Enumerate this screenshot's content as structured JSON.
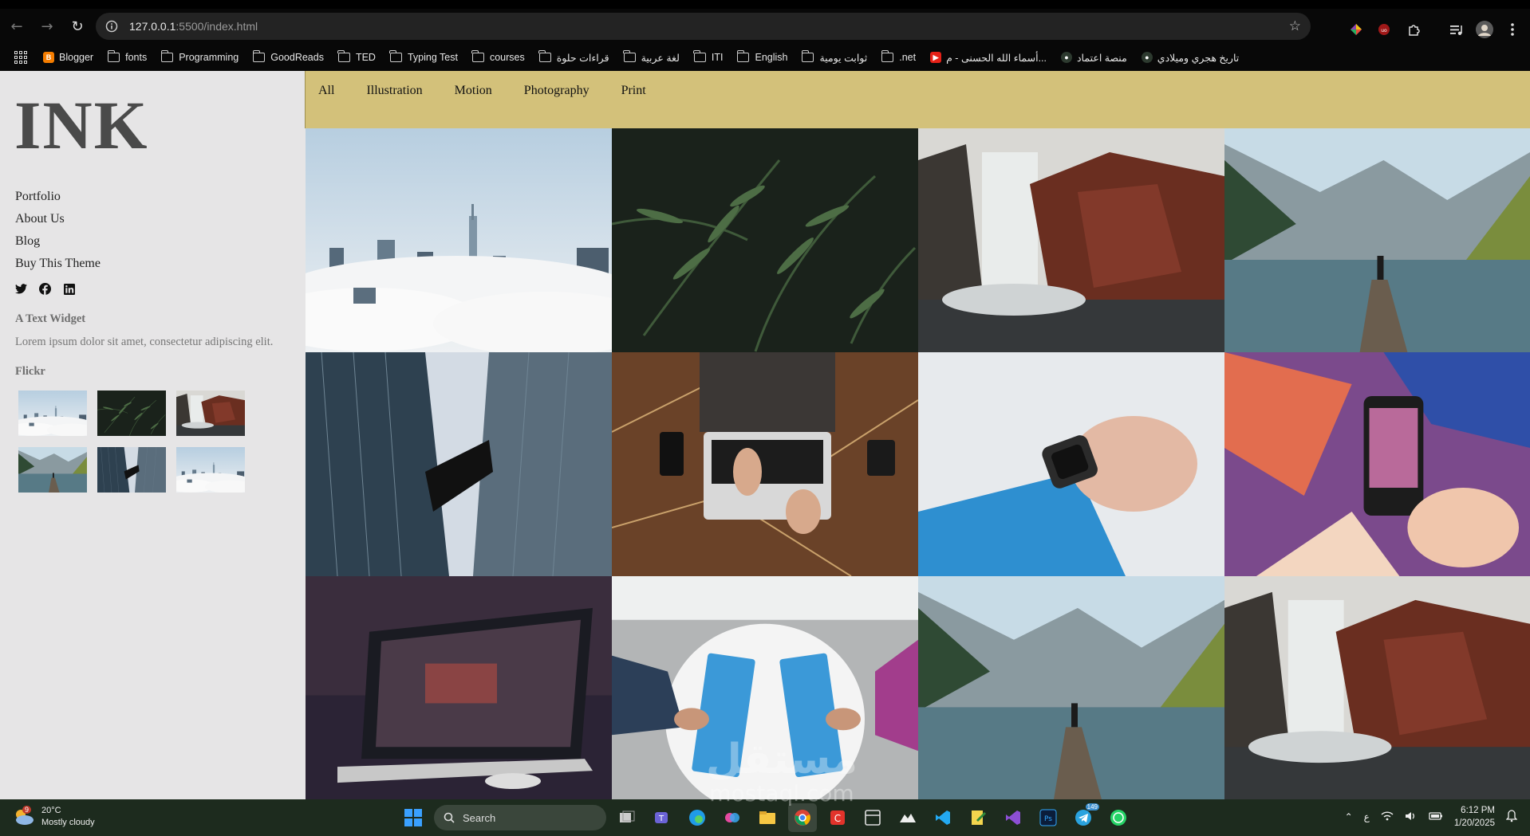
{
  "browser": {
    "url_host": "127.0.0.1",
    "url_rest": ":5500/index.html",
    "bookmarks": [
      {
        "label": "Blogger",
        "type": "blogger"
      },
      {
        "label": "fonts",
        "type": "folder"
      },
      {
        "label": "Programming",
        "type": "folder"
      },
      {
        "label": "GoodReads",
        "type": "folder"
      },
      {
        "label": "TED",
        "type": "folder"
      },
      {
        "label": "Typing Test",
        "type": "folder"
      },
      {
        "label": "courses",
        "type": "folder"
      },
      {
        "label": "قراءات حلوة",
        "type": "folder"
      },
      {
        "label": "لغة عربية",
        "type": "folder"
      },
      {
        "label": "ITI",
        "type": "folder"
      },
      {
        "label": "English",
        "type": "folder"
      },
      {
        "label": "ثوابت يومية",
        "type": "folder"
      },
      {
        "label": ".net",
        "type": "folder"
      },
      {
        "label": "أسماء الله الحسنى - م...",
        "type": "youtube"
      },
      {
        "label": "منصة اعتماد",
        "type": "site"
      },
      {
        "label": "تاريخ هجري وميلادي",
        "type": "site"
      }
    ]
  },
  "site": {
    "logo": "INK",
    "menu": [
      "Portfolio",
      "About Us",
      "Blog",
      "Buy This Theme"
    ],
    "socials": [
      "twitter-icon",
      "facebook-icon",
      "linkedin-icon"
    ],
    "text_widget": {
      "title": "A Text Widget",
      "body": "Lorem ipsum dolor sit amet, consectetur adipiscing elit."
    },
    "flickr_title": "Flickr",
    "flickr_thumbs": [
      "city-clouds",
      "fern-leaves",
      "waterfall",
      "lake-dock",
      "skyscrapers",
      "city-clouds"
    ],
    "filters": [
      "All",
      "Illustration",
      "Motion",
      "Photography",
      "Print"
    ],
    "gallery": [
      "city-clouds",
      "fern-leaves",
      "waterfall",
      "lake-dock",
      "skyscrapers",
      "laptop-desk",
      "smartwatch",
      "phone-art",
      "laptop-dark",
      "typing-table",
      "lake-dock",
      "waterfall"
    ],
    "accent": "#d3c17a",
    "sidebar_bg": "#e6e5e6"
  },
  "taskbar": {
    "weather_temp": "20°C",
    "weather_desc": "Mostly cloudy",
    "weather_badge": "9",
    "search_label": "Search",
    "lang": "ع",
    "time": "6:12 PM",
    "date": "1/20/2025",
    "telegram_badge": "149"
  },
  "watermark": {
    "arabic": "مستقل",
    "latin": "mostaql.com"
  }
}
